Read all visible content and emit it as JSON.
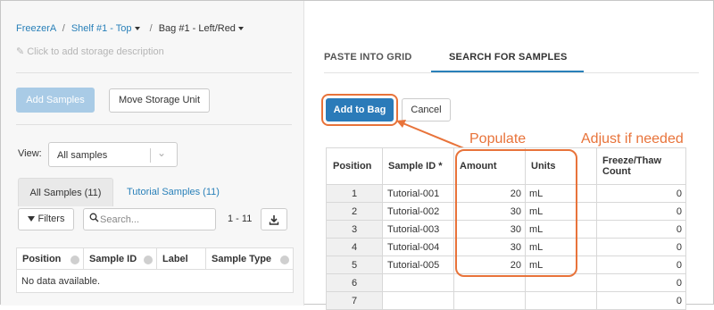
{
  "breadcrumb": {
    "freezer": "FreezerA",
    "shelf": "Shelf #1 - Top",
    "bag": "Bag #1 - Left/Red"
  },
  "storage_description_placeholder": "Click to add storage description",
  "buttons": {
    "add_samples": "Add Samples",
    "move_storage_unit": "Move Storage Unit",
    "add_to_bag": "Add to Bag",
    "cancel": "Cancel",
    "filters": "Filters"
  },
  "view": {
    "label": "View:",
    "selected": "All samples"
  },
  "left_tabs": [
    "All Samples (11)",
    "Tutorial Samples (11)"
  ],
  "search": {
    "placeholder": "Search..."
  },
  "paging": "1 - 11",
  "left_table": {
    "columns": [
      "Position",
      "Sample ID",
      "Label",
      "Sample Type"
    ],
    "empty_text": "No data available."
  },
  "right_tabs": [
    "PASTE INTO GRID",
    "SEARCH FOR SAMPLES"
  ],
  "annotations": {
    "populate": "Populate",
    "adjust": "Adjust if needed",
    "color": "#e8733a"
  },
  "grid": {
    "columns": [
      "Position",
      "Sample ID *",
      "Amount",
      "Units",
      "Freeze/Thaw Count"
    ],
    "rows": [
      {
        "position": "1",
        "sample_id": "Tutorial-001",
        "amount": "20",
        "units": "mL",
        "freeze_thaw": "0"
      },
      {
        "position": "2",
        "sample_id": "Tutorial-002",
        "amount": "30",
        "units": "mL",
        "freeze_thaw": "0"
      },
      {
        "position": "3",
        "sample_id": "Tutorial-003",
        "amount": "30",
        "units": "mL",
        "freeze_thaw": "0"
      },
      {
        "position": "4",
        "sample_id": "Tutorial-004",
        "amount": "30",
        "units": "mL",
        "freeze_thaw": "0"
      },
      {
        "position": "5",
        "sample_id": "Tutorial-005",
        "amount": "20",
        "units": "mL",
        "freeze_thaw": "0"
      },
      {
        "position": "6",
        "sample_id": "",
        "amount": "",
        "units": "",
        "freeze_thaw": "0"
      },
      {
        "position": "7",
        "sample_id": "",
        "amount": "",
        "units": "",
        "freeze_thaw": "0"
      }
    ]
  },
  "colors": {
    "primary": "#2b7bb9",
    "link": "#2980b9",
    "disabled_primary": "#a9cbe6"
  }
}
